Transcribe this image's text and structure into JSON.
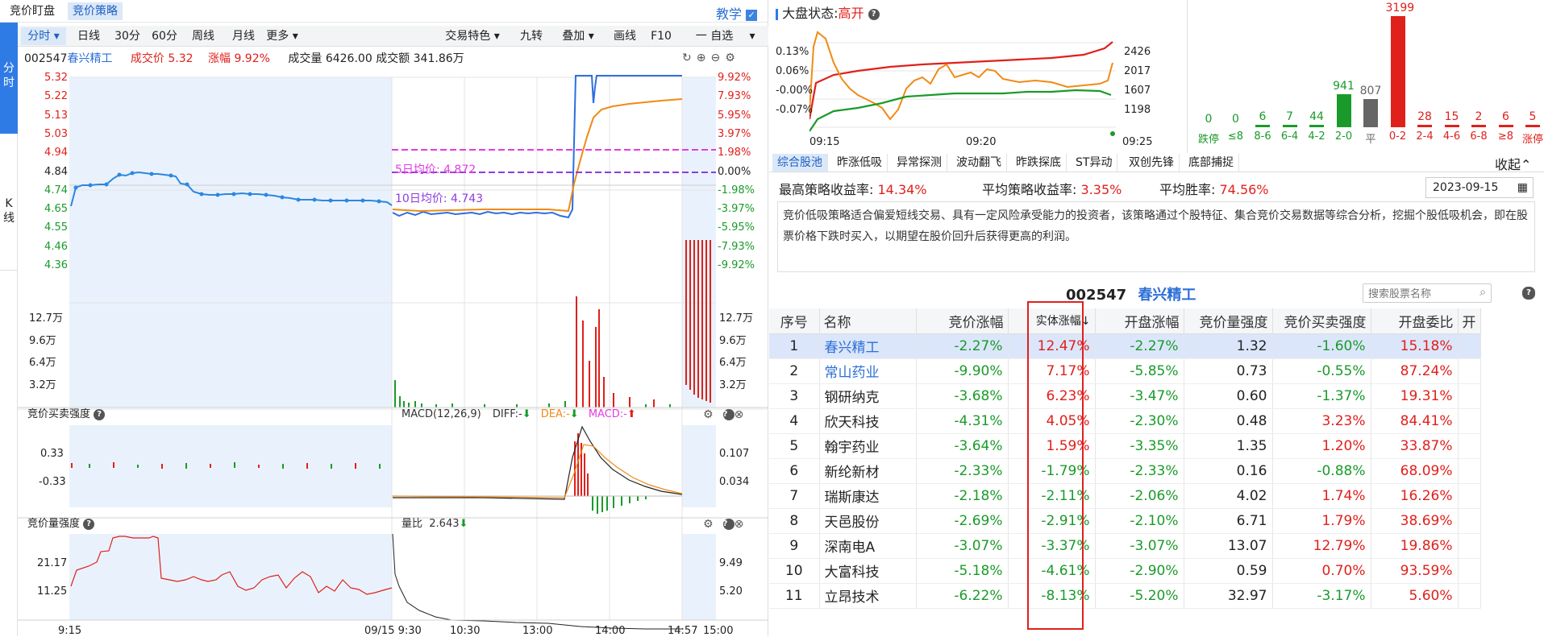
{
  "top_tabs": [
    "竞价盯盘",
    "竞价策略"
  ],
  "teach_label": "教学",
  "side_nav": {
    "fenshi": "分时",
    "kline": "K线"
  },
  "periods": [
    "分时",
    "日线",
    "30分",
    "60分",
    "周线",
    "月线",
    "更多"
  ],
  "tools": [
    "交易特色",
    "九转",
    "叠加",
    "画线",
    "F10"
  ],
  "self_select": "一 自选",
  "info": {
    "code": "002547",
    "name": "春兴精工",
    "price_label": "成交价",
    "price": "5.32",
    "change_label": "涨幅",
    "change": "9.92%",
    "volume_label": "成交量",
    "volume": "6426.00",
    "amount_label": "成交额",
    "amount": "341.86万"
  },
  "main_chart": {
    "left_ticks": [
      "5.32",
      "5.22",
      "5.13",
      "5.03",
      "4.94",
      "4.84",
      "4.74",
      "4.65",
      "4.55",
      "4.46",
      "4.36"
    ],
    "right_ticks": [
      "9.92%",
      "7.93%",
      "5.95%",
      "3.97%",
      "1.98%",
      "0.00%",
      "-1.98%",
      "-3.97%",
      "-5.95%",
      "-7.93%",
      "-9.92%"
    ],
    "ma5_label": "5日均价: 4.872",
    "ma10_label": "10日均价: 4.743",
    "vol_left_ticks": [
      "12.7万",
      "9.6万",
      "6.4万",
      "3.2万"
    ],
    "vol_right_ticks": [
      "12.7万",
      "9.6万",
      "6.4万",
      "3.2万"
    ]
  },
  "macd_panel": {
    "title": "竞价买卖强度",
    "macd_label": "MACD(12,26,9)",
    "diff_label": "DIFF:-",
    "dea_label": "DEA:-",
    "macd_val_label": "MACD:-",
    "left_ticks": [
      "0.33",
      "-0.33"
    ],
    "right_ticks": [
      "0.107",
      "0.034"
    ]
  },
  "volstr_panel": {
    "title": "竞价量强度",
    "ratio_label": "量比",
    "ratio_value": "2.643",
    "left_ticks": [
      "21.17",
      "11.25"
    ],
    "right_ticks": [
      "9.49",
      "5.20"
    ]
  },
  "time_axis": [
    "9:15",
    "09/15 9:30",
    "10:30",
    "13:00",
    "14:00",
    "14:57",
    "15:00"
  ],
  "market": {
    "label": "大盘状态:",
    "status": "高开",
    "left_ticks": [
      "0.13%",
      "0.06%",
      "-0.00%",
      "-0.07%"
    ],
    "right_ticks": [
      "2426",
      "2017",
      "1607",
      "1198"
    ],
    "times": [
      "09:15",
      "09:20",
      "09:25"
    ]
  },
  "distribution": [
    {
      "label": "跌停",
      "value": 0,
      "color": "#1a9a2a"
    },
    {
      "label": "≤8",
      "value": 0,
      "color": "#1a9a2a"
    },
    {
      "label": "8-6",
      "value": 6,
      "color": "#1a9a2a"
    },
    {
      "label": "6-4",
      "value": 7,
      "color": "#1a9a2a"
    },
    {
      "label": "4-2",
      "value": 44,
      "color": "#1a9a2a"
    },
    {
      "label": "2-0",
      "value": 941,
      "color": "#1a9a2a"
    },
    {
      "label": "平",
      "value": 807,
      "color": "#666666"
    },
    {
      "label": "0-2",
      "value": 3199,
      "color": "#e0201b"
    },
    {
      "label": "2-4",
      "value": 28,
      "color": "#e0201b"
    },
    {
      "label": "4-6",
      "value": 15,
      "color": "#e0201b"
    },
    {
      "label": "6-8",
      "value": 2,
      "color": "#e0201b"
    },
    {
      "label": "≥8",
      "value": 6,
      "color": "#e0201b"
    },
    {
      "label": "涨停",
      "value": 5,
      "color": "#e0201b"
    }
  ],
  "strategy_tabs": [
    "综合股池",
    "昨涨低吸",
    "异常探测",
    "波动翻飞",
    "昨跌探底",
    "ST异动",
    "双创先锋",
    "底部捕捉"
  ],
  "collapse_label": "收起",
  "stats": {
    "max_label": "最高策略收益率:",
    "max_value": "14.34%",
    "avg_label": "平均策略收益率:",
    "avg_value": "3.35%",
    "win_label": "平均胜率:",
    "win_value": "74.56%",
    "date": "2023-09-15"
  },
  "description": "竞价低吸策略适合偏爱短线交易、具有一定风险承受能力的投资者，该策略通过个股特征、集合竞价交易数据等综合分析，挖掘个股低吸机会，即在股票价格下跌时买入，以期望在股价回升后获得更高的利润。",
  "selected": {
    "code": "002547",
    "name": "春兴精工"
  },
  "search_placeholder": "搜索股票名称",
  "table": {
    "headers": [
      "序号",
      "名称",
      "竞价涨幅",
      "实体涨幅↓",
      "开盘涨幅",
      "竞价量强度",
      "竞价买卖强度",
      "开盘委比",
      "开"
    ],
    "rows": [
      [
        "1",
        "春兴精工",
        "-2.27%",
        "12.47%",
        "-2.27%",
        "1.32",
        "-1.60%",
        "15.18%"
      ],
      [
        "2",
        "常山药业",
        "-9.90%",
        "7.17%",
        "-5.85%",
        "0.73",
        "-0.55%",
        "87.24%"
      ],
      [
        "3",
        "钢研纳克",
        "-3.68%",
        "6.23%",
        "-3.47%",
        "0.60",
        "-1.37%",
        "19.31%"
      ],
      [
        "4",
        "欣天科技",
        "-4.31%",
        "4.05%",
        "-2.30%",
        "0.48",
        "3.23%",
        "84.41%"
      ],
      [
        "5",
        "翰宇药业",
        "-3.64%",
        "1.59%",
        "-3.35%",
        "1.35",
        "1.20%",
        "33.87%"
      ],
      [
        "6",
        "新纶新材",
        "-2.33%",
        "-1.79%",
        "-2.33%",
        "0.16",
        "-0.88%",
        "68.09%"
      ],
      [
        "7",
        "瑞斯康达",
        "-2.18%",
        "-2.11%",
        "-2.06%",
        "4.02",
        "1.74%",
        "16.26%"
      ],
      [
        "8",
        "天邑股份",
        "-2.69%",
        "-2.91%",
        "-2.10%",
        "6.71",
        "1.79%",
        "38.69%"
      ],
      [
        "9",
        "深南电A",
        "-3.07%",
        "-3.37%",
        "-3.07%",
        "13.07",
        "12.79%",
        "19.86%"
      ],
      [
        "10",
        "大富科技",
        "-5.18%",
        "-4.61%",
        "-2.90%",
        "0.59",
        "0.70%",
        "93.59%"
      ],
      [
        "11",
        "立昂技术",
        "-6.22%",
        "-8.13%",
        "-5.20%",
        "32.97",
        "-3.17%",
        "5.60%"
      ]
    ]
  }
}
